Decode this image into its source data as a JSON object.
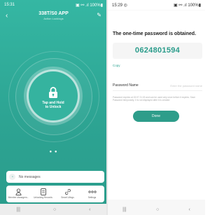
{
  "left": {
    "status": {
      "time": "15:31",
      "indicators": "▣ ⚯ .ıl 100%▮"
    },
    "header": {
      "title": "338T/S0 APP",
      "subtitle": "Action Lock/ogs"
    },
    "unlock": {
      "label_line1": "Tap and Hold",
      "label_line2": "to Unlock",
      "icon": "lock-icon"
    },
    "pager": "● ●",
    "messages": {
      "text": "No messages",
      "icon": "bell-icon"
    },
    "tabs": [
      {
        "label": "Member Managem...",
        "icon": "person-icon"
      },
      {
        "label": "Unlocking Records",
        "icon": "records-icon"
      },
      {
        "label": "Smart Lifings",
        "icon": "link-icon"
      },
      {
        "label": "Settings",
        "icon": "more-icon"
      }
    ],
    "navbar": {
      "recent": "|||",
      "home": "○",
      "back": "‹"
    }
  },
  "right": {
    "status": {
      "time": "15:29 ◎",
      "indicators": "▣ ⚯ .ıl 100%▮"
    },
    "title": "The one-time password is obtained.",
    "otp": "0624801594",
    "copy_label": "Copy",
    "password_name_label": "Password Name",
    "password_name_placeholder": "Enter the password name",
    "note": "Password expires at 15:07 21.03 and can be used only once before it expires. Save Password temporarily. It is not displayed after it is created",
    "done_label": "Done",
    "navbar": {
      "recent": "|||",
      "home": "○",
      "back": "‹"
    }
  },
  "colors": {
    "accent": "#2e9d8a",
    "otp_text": "#2a9c8b"
  }
}
